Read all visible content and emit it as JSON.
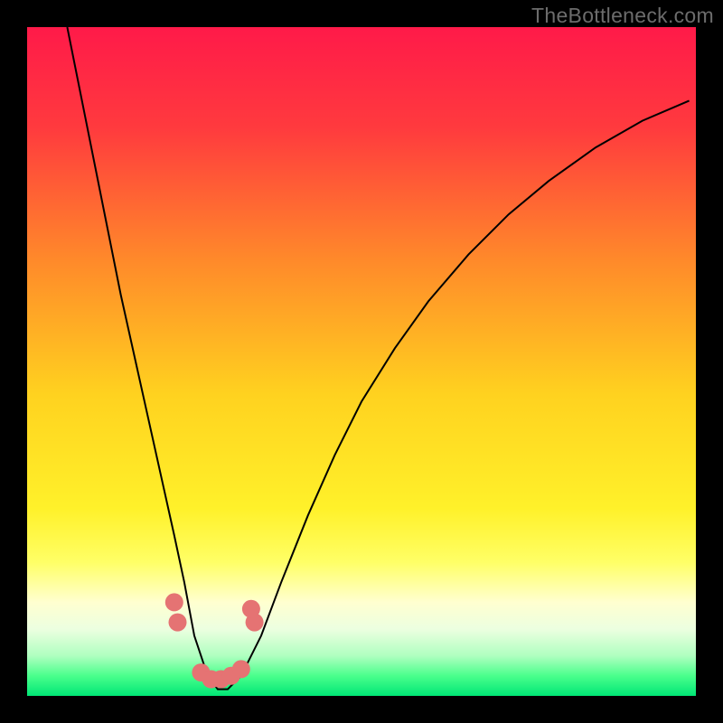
{
  "watermark": "TheBottleneck.com",
  "chart_data": {
    "type": "line",
    "title": "",
    "xlabel": "",
    "ylabel": "",
    "xlim": [
      0,
      100
    ],
    "ylim": [
      0,
      100
    ],
    "background_gradient": {
      "stops": [
        {
          "offset": 0.0,
          "color": "#ff1a49"
        },
        {
          "offset": 0.15,
          "color": "#ff3a3e"
        },
        {
          "offset": 0.35,
          "color": "#ff8a2a"
        },
        {
          "offset": 0.55,
          "color": "#ffd21f"
        },
        {
          "offset": 0.72,
          "color": "#fff12a"
        },
        {
          "offset": 0.8,
          "color": "#ffff66"
        },
        {
          "offset": 0.86,
          "color": "#ffffd0"
        },
        {
          "offset": 0.9,
          "color": "#ecffe0"
        },
        {
          "offset": 0.94,
          "color": "#b0ffc0"
        },
        {
          "offset": 0.97,
          "color": "#4aff8c"
        },
        {
          "offset": 1.0,
          "color": "#00e676"
        }
      ]
    },
    "series": [
      {
        "name": "bottleneck-curve",
        "color": "#000000",
        "x": [
          6,
          8,
          10,
          12,
          14,
          16,
          18,
          20,
          22,
          23.5,
          25,
          27,
          28.5,
          30,
          32,
          35,
          38,
          42,
          46,
          50,
          55,
          60,
          66,
          72,
          78,
          85,
          92,
          99
        ],
        "y": [
          100,
          90,
          80,
          70,
          60,
          51,
          42,
          33,
          24,
          17,
          9,
          3,
          1,
          1,
          3,
          9,
          17,
          27,
          36,
          44,
          52,
          59,
          66,
          72,
          77,
          82,
          86,
          89
        ]
      }
    ],
    "markers": {
      "name": "sample-points",
      "color": "#e57373",
      "points": [
        {
          "x": 22.0,
          "y": 14.0
        },
        {
          "x": 22.5,
          "y": 11.0
        },
        {
          "x": 26.0,
          "y": 3.5
        },
        {
          "x": 27.5,
          "y": 2.5
        },
        {
          "x": 29.0,
          "y": 2.5
        },
        {
          "x": 30.5,
          "y": 3.0
        },
        {
          "x": 32.0,
          "y": 4.0
        },
        {
          "x": 34.0,
          "y": 11.0
        },
        {
          "x": 33.5,
          "y": 13.0
        }
      ]
    }
  }
}
